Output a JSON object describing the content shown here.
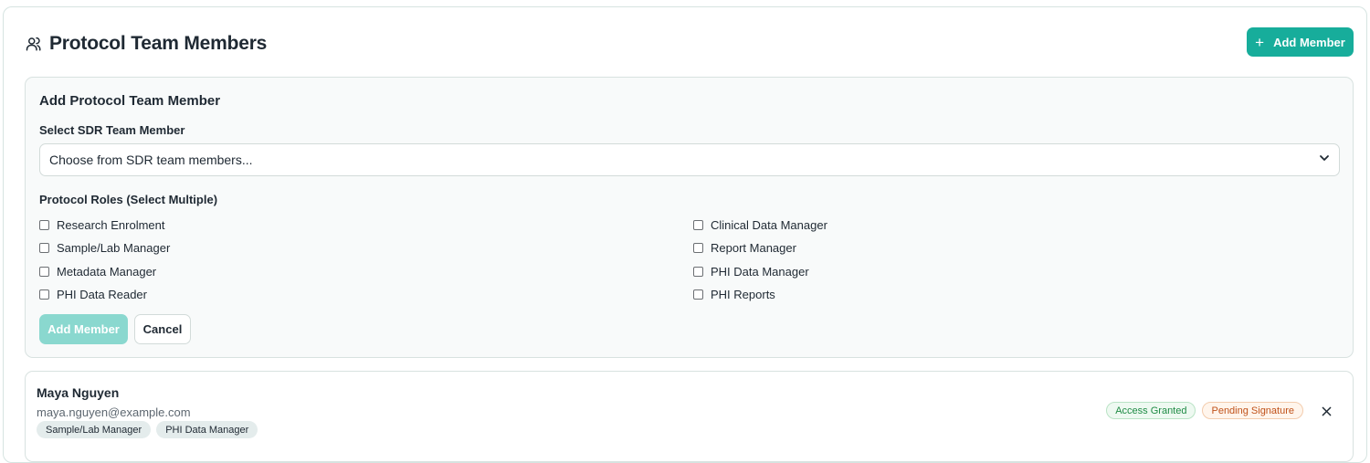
{
  "header": {
    "title": "Protocol Team Members",
    "title_icon": "users-icon",
    "add_button_label": "Add Member",
    "add_button_icon": "plus-icon",
    "accent_color": "#17ad9b"
  },
  "form": {
    "title": "Add Protocol Team Member",
    "select_label": "Select SDR Team Member",
    "select_value": "Choose from SDR team members...",
    "roles_label": "Protocol Roles (Select Multiple)",
    "roles": [
      {
        "label": "Research Enrolment",
        "checked": false
      },
      {
        "label": "Clinical Data Manager",
        "checked": false
      },
      {
        "label": "Sample/Lab Manager",
        "checked": false
      },
      {
        "label": "Report Manager",
        "checked": false
      },
      {
        "label": "Metadata Manager",
        "checked": false
      },
      {
        "label": "PHI Data Manager",
        "checked": false
      },
      {
        "label": "PHI Data Reader",
        "checked": false
      },
      {
        "label": "PHI Reports",
        "checked": false
      }
    ],
    "submit_label": "Add Member",
    "cancel_label": "Cancel"
  },
  "members": [
    {
      "name": "Maya Nguyen",
      "email": "maya.nguyen@example.com",
      "roles": [
        "Sample/Lab Manager",
        "PHI Data Manager"
      ],
      "badges": [
        {
          "label": "Access Granted",
          "status": "success",
          "color": "#1f8b45"
        },
        {
          "label": "Pending Signature",
          "status": "warning",
          "color": "#c0521a"
        }
      ]
    }
  ]
}
